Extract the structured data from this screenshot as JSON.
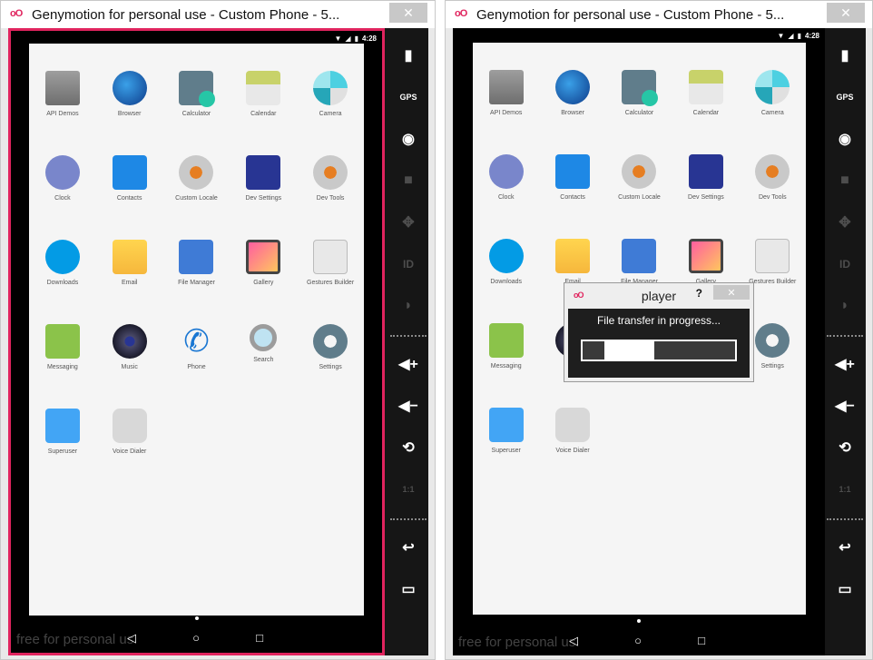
{
  "window1": {
    "title": "Genymotion for personal use - Custom Phone - 5...",
    "close_label": "✕",
    "watermark": "free for personal us"
  },
  "window2": {
    "title": "Genymotion for personal use - Custom Phone - 5...",
    "close_label": "✕",
    "watermark": "free for personal us"
  },
  "status_bar": {
    "clock": "4:28"
  },
  "apps": [
    {
      "label": "API Demos",
      "icon": "folder-gear-icon"
    },
    {
      "label": "Browser",
      "icon": "globe-icon"
    },
    {
      "label": "Calculator",
      "icon": "calculator-icon"
    },
    {
      "label": "Calendar",
      "icon": "calendar-icon"
    },
    {
      "label": "Camera",
      "icon": "camera-lens-icon"
    },
    {
      "label": "Clock",
      "icon": "clock-icon"
    },
    {
      "label": "Contacts",
      "icon": "contact-card-icon"
    },
    {
      "label": "Custom Locale",
      "icon": "gears-icon"
    },
    {
      "label": "Dev Settings",
      "icon": "sliders-icon"
    },
    {
      "label": "Dev Tools",
      "icon": "gears-icon"
    },
    {
      "label": "Downloads",
      "icon": "download-arrow-icon"
    },
    {
      "label": "Email",
      "icon": "envelope-at-icon"
    },
    {
      "label": "File Manager",
      "icon": "circle-icon"
    },
    {
      "label": "Gallery",
      "icon": "picture-frame-icon"
    },
    {
      "label": "Gestures Builder",
      "icon": "gesture-icon"
    },
    {
      "label": "Messaging",
      "icon": "speech-bubble-icon"
    },
    {
      "label": "Music",
      "icon": "speaker-icon"
    },
    {
      "label": "Phone",
      "icon": "phone-handset-icon"
    },
    {
      "label": "Search",
      "icon": "magnifier-icon"
    },
    {
      "label": "Settings",
      "icon": "settings-gear-icon"
    },
    {
      "label": "Superuser",
      "icon": "hash-icon"
    },
    {
      "label": "Voice Dialer",
      "icon": "speaker-grille-icon"
    }
  ],
  "sidebar": {
    "gps_label": "GPS",
    "id_label": "ID",
    "pixel_label": "1:1"
  },
  "nav": {
    "back": "◁",
    "home": "○",
    "recents": "□"
  },
  "dialog": {
    "title": "player",
    "help": "?",
    "close": "✕",
    "message": "File transfer in progress...",
    "progress": 0.55
  },
  "colors": {
    "highlight_border": "#e0245e",
    "dialog_bg": "#1e1e1e"
  }
}
